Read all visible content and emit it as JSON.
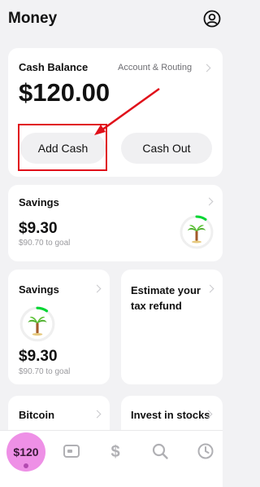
{
  "header": {
    "title": "Money",
    "profile_icon": "profile-icon"
  },
  "cash_balance": {
    "label": "Cash Balance",
    "routing_link": "Account & Routing",
    "amount": "$120.00",
    "add_cash_label": "Add Cash",
    "cash_out_label": "Cash Out"
  },
  "savings_wide": {
    "label": "Savings",
    "amount": "$9.30",
    "goal_text": "$90.70 to goal",
    "goal_progress": 0.093
  },
  "savings_tile": {
    "label": "Savings",
    "amount": "$9.30",
    "goal_text": "$90.70 to goal",
    "goal_progress": 0.093
  },
  "tax_tile": {
    "label": "Estimate your tax refund"
  },
  "bitcoin_tile": {
    "label": "Bitcoin"
  },
  "stocks_tile": {
    "label": "Invest in stocks"
  },
  "tabbar": {
    "balance_label": "$120",
    "items": [
      "card-icon",
      "dollar-icon",
      "search-icon",
      "clock-icon"
    ]
  },
  "colors": {
    "accent_green": "#00d632",
    "annotation_red": "#e0101a",
    "tab_pink": "#ee90e6"
  }
}
